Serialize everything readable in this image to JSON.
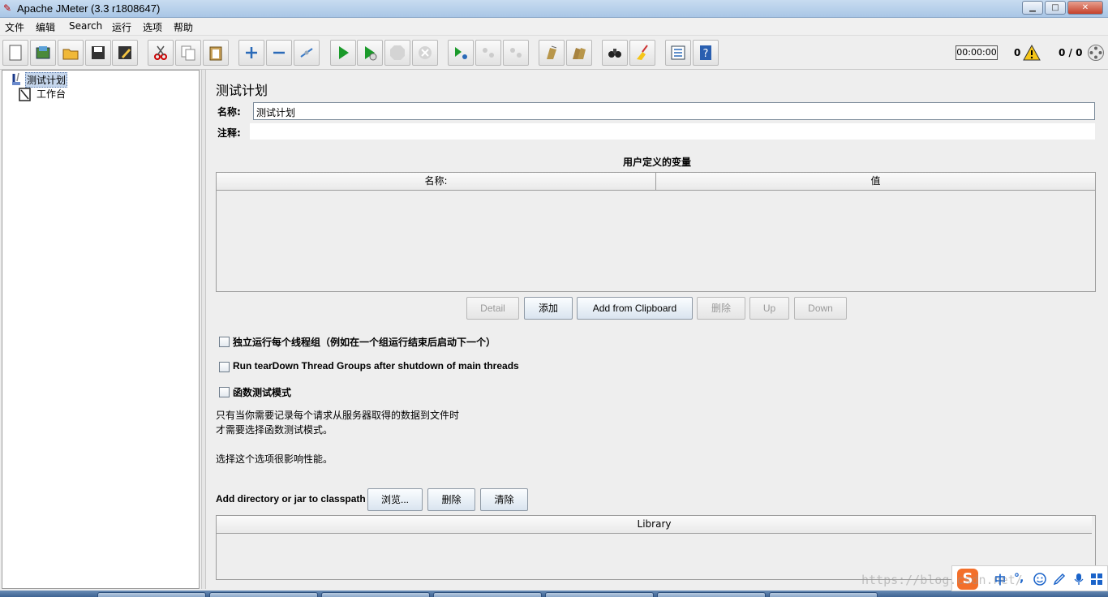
{
  "window": {
    "title": "Apache JMeter (3.3 r1808647)"
  },
  "menu": [
    "文件",
    "编辑",
    "Search",
    "运行",
    "选项",
    "帮助"
  ],
  "toolbar_icons": [
    "new-icon",
    "templates-icon",
    "open-icon",
    "save-icon",
    "save-as-icon",
    "cut-icon",
    "copy-icon",
    "paste-icon",
    "expand-icon",
    "collapse-icon",
    "toggle-icon",
    "start-icon",
    "start-no-timers-icon",
    "stop-icon",
    "shutdown-icon",
    "remote-start-icon",
    "remote-stop-icon",
    "remote-shutdown-icon",
    "clear-icon",
    "clear-all-icon",
    "search-icon",
    "reset-search-icon",
    "function-helper-icon",
    "help-icon"
  ],
  "status": {
    "timer": "00:00:00",
    "errors": "0",
    "threads": "0 / 0"
  },
  "tree": {
    "items": [
      "测试计划",
      "工作台"
    ]
  },
  "panel": {
    "title": "测试计划",
    "name_label": "名称:",
    "name_value": "测试计划",
    "comment_label": "注释:",
    "comment_value": "",
    "variables_title": "用户定义的变量",
    "variables_columns": [
      "名称:",
      "值"
    ],
    "buttons": {
      "detail": "Detail",
      "add": "添加",
      "add_clipboard": "Add from Clipboard",
      "delete": "删除",
      "up": "Up",
      "down": "Down"
    },
    "checkboxes": [
      "独立运行每个线程组（例如在一个组运行结束后启动下一个）",
      "Run tearDown Thread Groups after shutdown of main threads",
      "函数测试模式"
    ],
    "notes": [
      "只有当你需要记录每个请求从服务器取得的数据到文件时",
      "才需要选择函数测试模式。",
      "选择这个选项很影响性能。"
    ],
    "classpath_label": "Add directory or jar to classpath",
    "classpath_buttons": {
      "browse": "浏览...",
      "delete": "删除",
      "clear": "清除"
    },
    "library_column": "Library"
  },
  "ime": {
    "zh": "中",
    "punct": "°,"
  },
  "watermark": "https://blog.csdn.net/"
}
